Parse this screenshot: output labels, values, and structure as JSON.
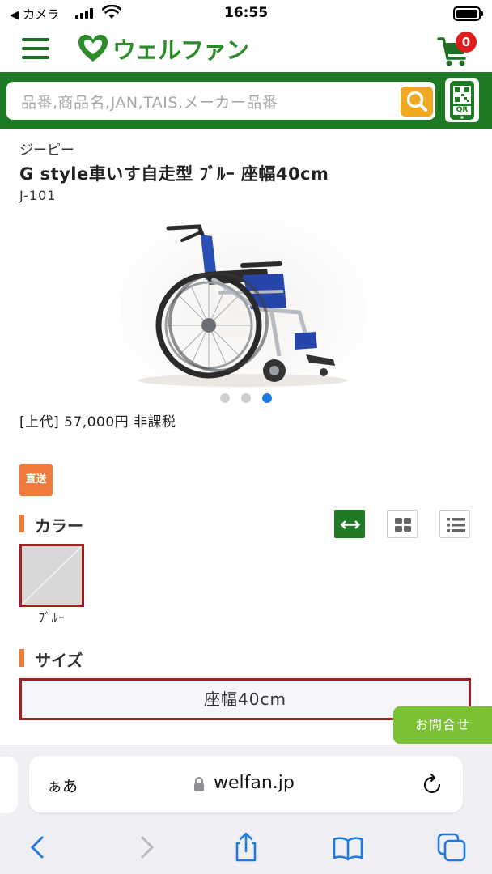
{
  "status_bar": {
    "back_label": "◀ カメラ",
    "time": "16:55"
  },
  "header": {
    "logo_text": "ウェルファン",
    "cart_count": "0"
  },
  "search": {
    "placeholder": "品番,商品名,JAN,TAIS,メーカー品番",
    "qr_label": "QR"
  },
  "product": {
    "maker": "ジーピー",
    "title": "G style車いす自走型 ﾌﾞﾙｰ 座幅40cm",
    "code": "J-101",
    "price": "[上代] 57,000円 非課税",
    "image_slides": 3,
    "active_slide": 3,
    "direct_badge": "直送"
  },
  "color_section": {
    "heading": "カラー",
    "options": [
      {
        "label": "ﾌﾞﾙｰ",
        "selected": true
      }
    ]
  },
  "size_section": {
    "heading": "サイズ",
    "options": [
      {
        "label": "座幅40cm",
        "selected": true
      }
    ]
  },
  "contact_button": "お問合せ",
  "browser": {
    "text_size_label": "ぁあ",
    "url": "welfan.jp"
  },
  "colors": {
    "brand_green": "#1e7a24",
    "accent_orange": "#ee7a3c",
    "selected_border": "#a01f22",
    "contact_green": "#7cc134",
    "cart_badge_red": "#e01b1b",
    "ios_blue": "#1f7ae0"
  }
}
